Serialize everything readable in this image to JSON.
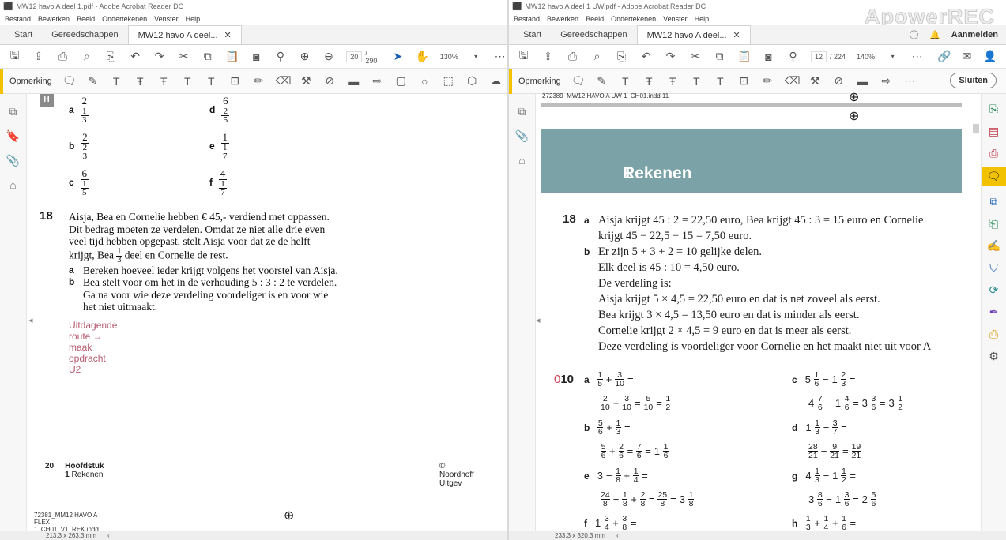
{
  "left": {
    "title": "MW12 havo A deel 1.pdf - Adobe Acrobat Reader DC",
    "menu": [
      "Bestand",
      "Bewerken",
      "Beeld",
      "Ondertekenen",
      "Venster",
      "Help"
    ],
    "tabs": {
      "start": "Start",
      "tools": "Gereedschappen",
      "doc": "MW12 havo A deel..."
    },
    "page_num": "20",
    "page_total": "/ 290",
    "zoom": "130%",
    "annotate_label": "Opmerking",
    "badge": "H",
    "options": [
      {
        "lab": "a",
        "top": "2",
        "num": "1",
        "den": "3"
      },
      {
        "lab": "b",
        "top": "2",
        "num": "2",
        "den": "3"
      },
      {
        "lab": "c",
        "top": "6",
        "num": "1",
        "den": "5"
      },
      {
        "lab": "d",
        "top": "6",
        "num": "2",
        "den": "5"
      },
      {
        "lab": "e",
        "top": "1",
        "num": "1",
        "den": "7"
      },
      {
        "lab": "f",
        "top": "4",
        "num": "1",
        "den": "7"
      }
    ],
    "q18_number": "18",
    "q18_lines": [
      "Aisja, Bea en Cornelie hebben € 45,- verdiend met oppassen.",
      "Dit bedrag moeten ze verdelen. Omdat ze niet alle drie even",
      "veel tijd hebben opgepast, stelt Aisja voor dat ze de helft"
    ],
    "q18_line4a": "krijgt, Bea",
    "q18_line4frac_n": "1",
    "q18_line4frac_d": "3",
    "q18_line4b": "deel en Cornelie de rest.",
    "q18_a_lab": "a",
    "q18_a": "Bereken hoeveel ieder krijgt volgens het voorstel van Aisja.",
    "q18_b_lab": "b",
    "q18_b1": "Bea stelt voor om het in de verhouding 5 : 3 : 2 te verdelen.",
    "q18_b2": "Ga na voor wie deze verdeling voordeliger is en voor wie",
    "q18_b3": "het niet uitmaakt.",
    "route": "Uitdagende route → maak opdracht U2",
    "footer_page": "20",
    "footer_chapter_bold": "Hoofdstuk 1",
    "footer_chapter": "Rekenen",
    "footer_copyright": "© Noordhoff Uitgev",
    "indd": "72381_MM12 HAVO A FLEX 1_CH01_V1_REK.indd   20",
    "status": "213,3 x 263,3 mm"
  },
  "right": {
    "title": "MW12 havo A deel 1 UW.pdf - Adobe Acrobat Reader DC",
    "menu": [
      "Bestand",
      "Bewerken",
      "Beeld",
      "Ondertekenen",
      "Venster",
      "Help"
    ],
    "tabs": {
      "start": "Start",
      "tools": "Gereedschappen",
      "doc": "MW12 havo A deel..."
    },
    "sign_in": "Aanmelden",
    "page_num": "12",
    "page_total": "/ 224",
    "zoom": "140%",
    "annotate_label": "Opmerking",
    "close_label": "Sluiten",
    "indd_top": "272389_MW12 HAVO A UW 1_CH01.indd   11",
    "chapter_num": "1",
    "chapter_title": "Rekenen",
    "q18_number": "18",
    "a_lab": "a",
    "a_lines": [
      "Aisja krijgt 45 : 2 = 22,50 euro, Bea krijgt 45 : 3 = 15 euro en Cornelie",
      "krijgt 45 − 22,5 − 15 = 7,50 euro."
    ],
    "b_lab": "b",
    "b_lines": [
      "Er zijn 5 + 3 + 2 = 10 gelijke delen.",
      "Elk deel is 45 : 10 = 4,50 euro.",
      "De verdeling is:",
      "Aisja krijgt 5 × 4,5 = 22,50 euro en dat is net zoveel als eerst.",
      "Bea krijgt 3 × 4,5 = 13,50 euro en dat is minder als eerst.",
      "Cornelie krijgt 2 × 4,5 = 9 euro en dat is meer als eerst.",
      "Deze verdeling is voordeliger voor Cornelie en het maakt niet uit voor A"
    ],
    "q10_prefix": "0",
    "q10_number": "10",
    "math_labels": {
      "a": "a",
      "b": "b",
      "c": "c",
      "d": "d",
      "e": "e",
      "f": "f",
      "g": "g",
      "h": "h"
    },
    "ops": {
      "plus": "+",
      "minus": "−",
      "eq": "="
    },
    "status": "233,3 x 320,3 mm"
  },
  "watermark": "ApowerREC"
}
